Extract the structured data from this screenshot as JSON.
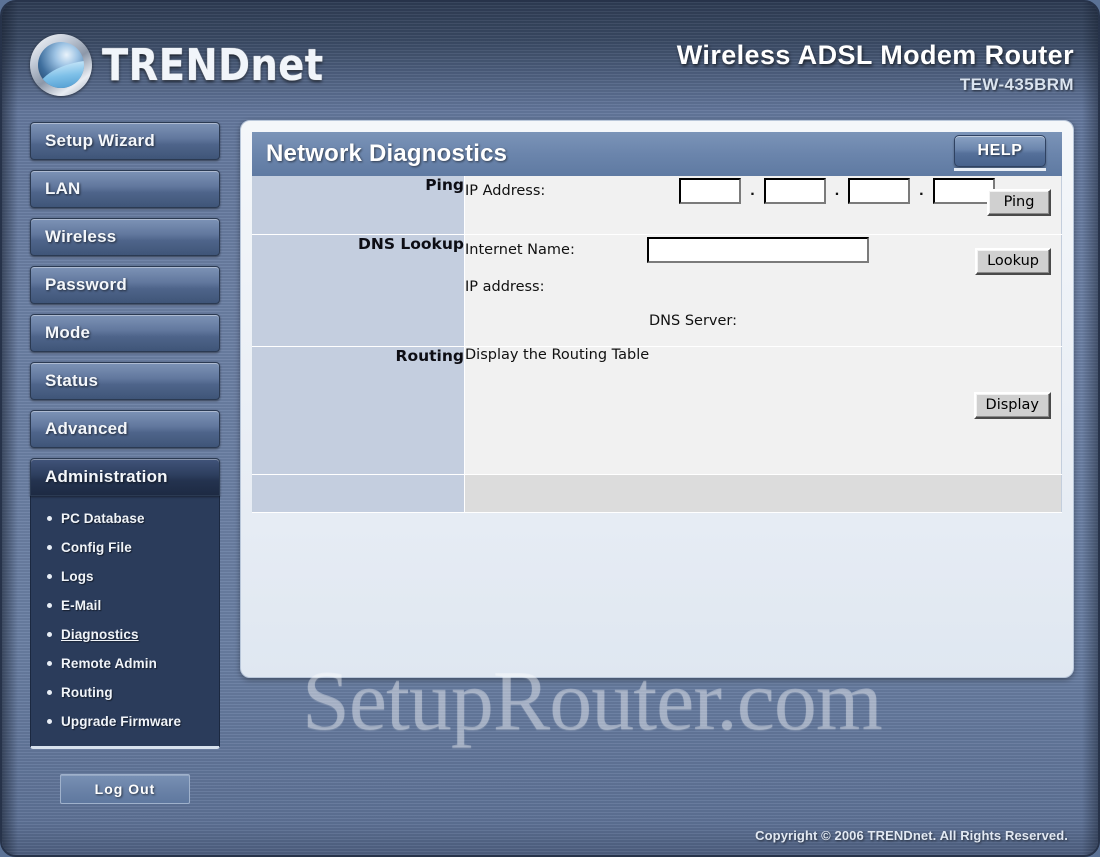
{
  "header": {
    "brand": "TRENDnet",
    "logo_icon": "trendnet-sphere-logo",
    "product_title": "Wireless ADSL Modem Router",
    "model": "TEW-435BRM"
  },
  "sidebar": {
    "items": [
      {
        "label": "Setup Wizard",
        "active": false
      },
      {
        "label": "LAN",
        "active": false
      },
      {
        "label": "Wireless",
        "active": false
      },
      {
        "label": "Password",
        "active": false
      },
      {
        "label": "Mode",
        "active": false
      },
      {
        "label": "Status",
        "active": false
      },
      {
        "label": "Advanced",
        "active": false
      },
      {
        "label": "Administration",
        "active": true
      }
    ],
    "submenu": [
      {
        "label": "PC Database",
        "current": false
      },
      {
        "label": "Config File",
        "current": false
      },
      {
        "label": "Logs",
        "current": false
      },
      {
        "label": "E-Mail",
        "current": false
      },
      {
        "label": "Diagnostics",
        "current": true
      },
      {
        "label": "Remote Admin",
        "current": false
      },
      {
        "label": "Routing",
        "current": false
      },
      {
        "label": "Upgrade Firmware",
        "current": false
      }
    ],
    "logout_label": "Log Out"
  },
  "panel": {
    "title": "Network Diagnostics",
    "help_label": "HELP",
    "rows": {
      "ping": {
        "section_label": "Ping",
        "field_label": "IP Address:",
        "octets": [
          "",
          "",
          "",
          ""
        ],
        "separator": ".",
        "button_label": "Ping"
      },
      "dns": {
        "section_label": "DNS Lookup",
        "field_label": "Internet Name:",
        "input_value": "",
        "button_label": "Lookup",
        "ip_address_label": "IP address:",
        "ip_address_value": "",
        "dns_server_label": "DNS Server:",
        "dns_server_value": ""
      },
      "routing": {
        "section_label": "Routing",
        "description": "Display the Routing Table",
        "button_label": "Display"
      }
    }
  },
  "watermark": "SetupRouter.com",
  "footer": {
    "copyright": "Copyright © 2006 TRENDnet. All Rights Reserved."
  }
}
